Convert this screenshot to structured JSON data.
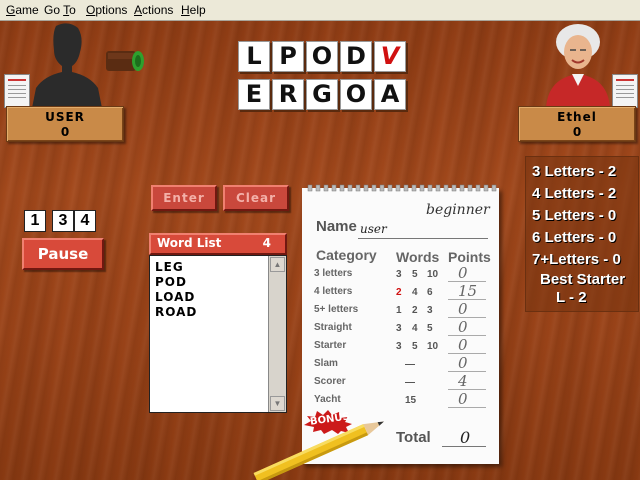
{
  "menu": {
    "items": [
      {
        "label": "Game",
        "accel": "G"
      },
      {
        "label": "Go To",
        "accel": "T"
      },
      {
        "label": "Options",
        "accel": "O"
      },
      {
        "label": "Actions",
        "accel": "A"
      },
      {
        "label": "Help",
        "accel": "H"
      }
    ]
  },
  "puzzle": {
    "row1": [
      "L",
      "P",
      "O",
      "D",
      "V"
    ],
    "row2": [
      "E",
      "R",
      "G",
      "O",
      "A"
    ],
    "highlighted_letter": "V"
  },
  "players": {
    "user": {
      "name": "USER",
      "score": "0"
    },
    "opponent": {
      "name": "Ethel",
      "score": "0"
    }
  },
  "controls": {
    "enter_label": "Enter",
    "clear_label": "Clear",
    "pause_label": "Pause",
    "timer_digits": [
      "1",
      "3",
      "4"
    ]
  },
  "word_list": {
    "title": "Word List",
    "count": "4",
    "words": [
      "LEG",
      "POD",
      "LOAD",
      "ROAD"
    ]
  },
  "opponent_stats": {
    "lines": [
      "3 Letters -  2",
      "4 Letters -  2",
      "5 Letters -  0",
      "6 Letters -  0",
      "7+Letters -  0"
    ],
    "best_starter_label": "Best Starter",
    "best_starter_value": "L  -  2"
  },
  "scorecard": {
    "level": "beginner",
    "name_label": "Name",
    "name_value": "user",
    "category_header": "Category",
    "words_header": "Words",
    "points_header": "Points",
    "rows": [
      {
        "category": "3 letters",
        "words": [
          "3",
          "5",
          "10"
        ],
        "points": "0"
      },
      {
        "category": "4 letters",
        "words": [
          "2",
          "4",
          "6"
        ],
        "points": "15"
      },
      {
        "category": "5+ letters",
        "words": [
          "1",
          "2",
          "3"
        ],
        "points": "0"
      },
      {
        "category": "Straight",
        "words": [
          "3",
          "4",
          "5"
        ],
        "points": "0"
      },
      {
        "category": "Starter",
        "words": [
          "3",
          "5",
          "10"
        ],
        "points": "0"
      },
      {
        "category": "Slam",
        "words": [
          "—"
        ],
        "points": "0"
      },
      {
        "category": "Scorer",
        "words": [
          "—"
        ],
        "points": "4"
      },
      {
        "category": "Yacht",
        "words": [
          "15"
        ],
        "points": "0"
      }
    ],
    "bonus_label": "BONUS",
    "total_label": "Total",
    "total_value": "0"
  },
  "colors": {
    "accent_red": "#d84a3a",
    "plaque_tan": "#c98a48",
    "highlight_letter": "#d01010",
    "counter_green": "#2ea02e"
  }
}
